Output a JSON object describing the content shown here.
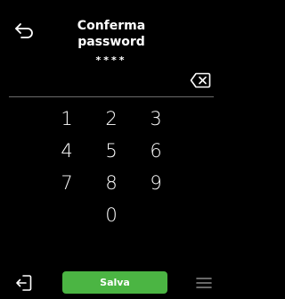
{
  "header": {
    "title_line1": "Conferma",
    "title_line2": "password",
    "masked_value": "****"
  },
  "icons": {
    "back": "back-arrow-icon",
    "backspace": "backspace-icon",
    "exit": "exit-icon",
    "menu": "menu-icon"
  },
  "keypad": {
    "keys": [
      "1",
      "2",
      "3",
      "4",
      "5",
      "6",
      "7",
      "8",
      "9",
      "0"
    ]
  },
  "footer": {
    "save_label": "Salva"
  },
  "colors": {
    "background": "#000000",
    "text": "#ffffff",
    "accent_green": "#4bb543",
    "divider": "#6b6b6b"
  }
}
